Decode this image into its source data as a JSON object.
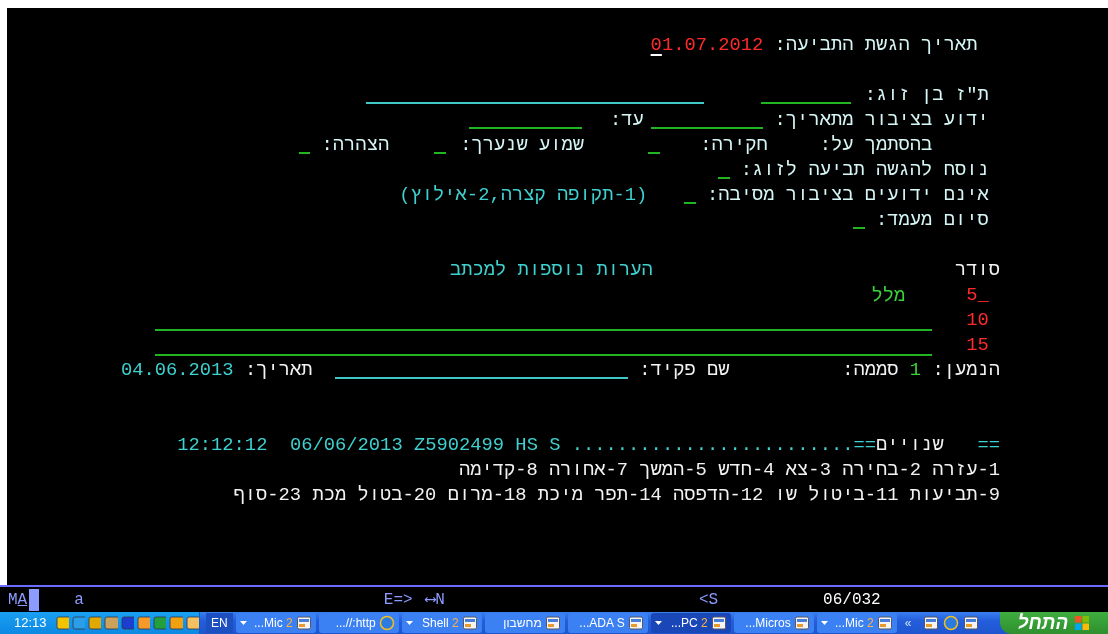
{
  "form": [
    {
      "items": [
        {
          "kind": "label",
          "text": "תאריך הגשת התביעה:"
        },
        {
          "kind": "value",
          "text": "01.07.2012",
          "cursor": true
        }
      ]
    },
    {
      "items": [
        {
          "kind": "label",
          "text": "ת\"ז בן זוג:"
        },
        {
          "kind": "field"
        },
        {
          "kind": "display-field"
        }
      ]
    },
    {
      "items": [
        {
          "kind": "label",
          "text": "ידוע בציבור מתאריך:"
        },
        {
          "kind": "field"
        },
        {
          "kind": "label",
          "text": "עד:"
        },
        {
          "kind": "field"
        }
      ]
    },
    {
      "items": [
        {
          "kind": "label",
          "text": "בהסתמך על:"
        },
        {
          "kind": "label",
          "text": "חקירה:"
        },
        {
          "kind": "field"
        },
        {
          "kind": "label",
          "text": "שמוע שנערך:"
        },
        {
          "kind": "field"
        },
        {
          "kind": "label",
          "text": "הצהרה:"
        },
        {
          "kind": "field"
        }
      ]
    },
    {
      "items": [
        {
          "kind": "label",
          "text": "נוסח להגשה תביעה לזוג:"
        },
        {
          "kind": "field"
        }
      ]
    },
    {
      "items": [
        {
          "kind": "label",
          "text": "אינם ידועים בציבור מסיבה:"
        },
        {
          "kind": "field"
        },
        {
          "kind": "info",
          "text": "(1-תקופה קצרה,2-אילוץ)"
        }
      ]
    },
    {
      "items": [
        {
          "kind": "label",
          "text": "סיום מעמד:"
        },
        {
          "kind": "field"
        }
      ]
    }
  ],
  "notes": {
    "number_heading": "סודר",
    "text_heading": "הערות נוספות למכתב",
    "rows": [
      {
        "number": "_5",
        "text": "מלל"
      },
      {
        "number": "10"
      },
      {
        "number": "15"
      }
    ]
  },
  "footer_line": {
    "items": [
      {
        "kind": "label",
        "text": "הנמען:"
      },
      {
        "kind": "input",
        "text": "1"
      },
      {
        "kind": "label",
        "text": "סממה:"
      },
      {
        "kind": "label",
        "text": "שם פקיד:"
      },
      {
        "kind": "display-field"
      },
      {
        "kind": "label",
        "text": "תאריך:"
      },
      {
        "kind": "info",
        "text": "04.06.2013"
      }
    ]
  },
  "status_line": {
    "marks": "==",
    "title": "שנויים",
    "info": "12:12:12  06/06/2013 Z5902499 HS S .........................=="
  },
  "function_keys": [
    "1-עזרה 2-בחירה 3-צא 4-חדש 5-המשך 7-אחורה 8-קדימה",
    "9-תביעות 11-ביטול שו 12-הדפסה 14-תפר מיכת 18-מרום 20-בטול מכת 23-סוף"
  ],
  "oia": {
    "mode": "MA",
    "input_mode": "a",
    "indicator_1": "E=>",
    "indicator_2": "⟷N",
    "indicator_3": "<S",
    "position": "06/032"
  },
  "taskbar": {
    "clock": "12:13",
    "language": "EN",
    "buttons": [
      {
        "label": "...Mic",
        "count": "2",
        "grouped": true,
        "selected": false
      },
      {
        "label": "...Micros",
        "grouped": false,
        "selected": false
      },
      {
        "label": "...PC",
        "count": "2",
        "grouped": true,
        "selected": true
      },
      {
        "label": "...ADA S",
        "grouped": false,
        "selected": false
      },
      {
        "label": "מחשבון",
        "grouped": false,
        "selected": false
      },
      {
        "label": "Shell",
        "count": "2",
        "grouped": true,
        "selected": false
      },
      {
        "label": "...//:http",
        "grouped": false,
        "selected": false,
        "kind": "browser"
      },
      {
        "label": "...Mic",
        "count": "2",
        "grouped": true,
        "selected": false
      }
    ],
    "more": "«",
    "start": "התחל"
  }
}
